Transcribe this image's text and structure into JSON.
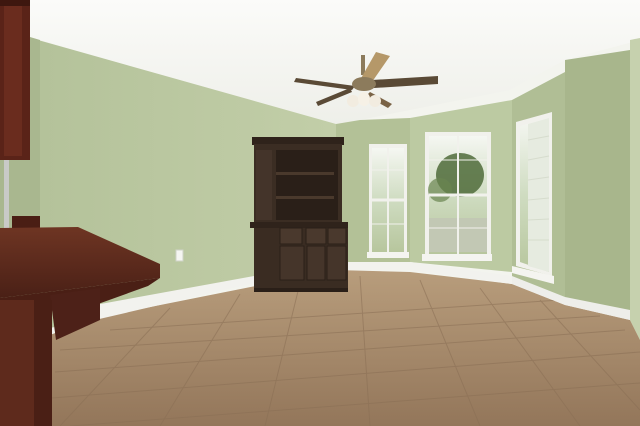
{
  "scene": {
    "description_colors": {
      "wall": "#b9c69e",
      "wall_light": "#c8d4ad",
      "ceiling": "#f6f7f3",
      "floor": "#a48a68",
      "cabinet": "#3a2c22",
      "counter": "#5b2a1c",
      "trim": "#f4f4f1"
    }
  }
}
